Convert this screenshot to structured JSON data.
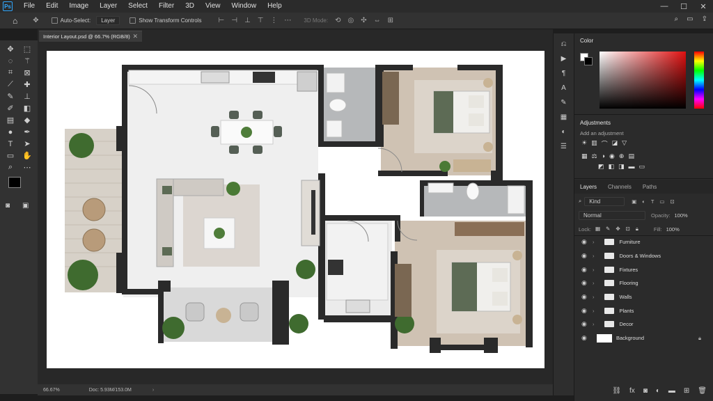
{
  "menu": {
    "logo": "Ps",
    "items": [
      "File",
      "Edit",
      "Image",
      "Layer",
      "Select",
      "Filter",
      "3D",
      "View",
      "Window",
      "Help"
    ]
  },
  "options": {
    "auto_select_label": "Auto-Select:",
    "auto_select_value": "Layer",
    "transform_label": "Show Transform Controls",
    "mode_3d_label": "3D Mode:"
  },
  "document": {
    "tab_title": "Interior Layout.psd @ 66.7% (RGB/8)",
    "zoom": "66.67%",
    "doc_size": "Doc: 5.93M/153.0M"
  },
  "panels": {
    "color_title": "Color",
    "adjustments_title": "Adjustments",
    "adjustments_hint": "Add an adjustment",
    "layers_tabs": [
      "Layers",
      "Channels",
      "Paths"
    ],
    "kind_filter": "Kind",
    "blend_mode": "Normal",
    "opacity_label": "Opacity:",
    "opacity_value": "100%",
    "lock_label": "Lock:",
    "fill_label": "Fill:",
    "fill_value": "100%"
  },
  "layers": [
    {
      "name": "Furniture",
      "type": "group"
    },
    {
      "name": "Doors & Windows",
      "type": "group"
    },
    {
      "name": "Fixtures",
      "type": "group"
    },
    {
      "name": "Flooring",
      "type": "group"
    },
    {
      "name": "Walls",
      "type": "group"
    },
    {
      "name": "Plants",
      "type": "group"
    },
    {
      "name": "Decor",
      "type": "group"
    },
    {
      "name": "Background",
      "type": "locked"
    }
  ],
  "colors": {
    "accent": "#31a8ff",
    "wall": "#2b2b2b",
    "bed_green": "#5d6b55",
    "wood": "#a58c72"
  }
}
